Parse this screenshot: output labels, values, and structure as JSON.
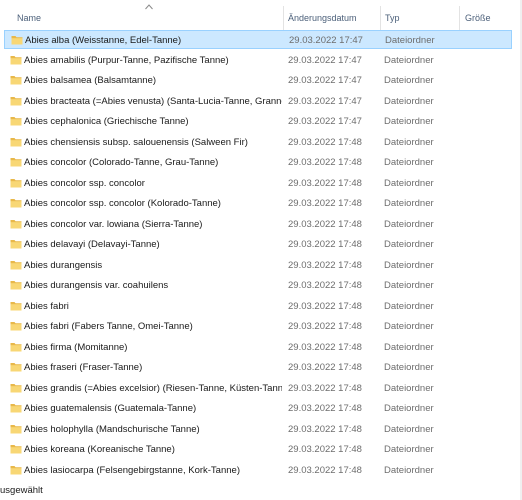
{
  "columns": {
    "name": "Name",
    "date": "Änderungsdatum",
    "type": "Typ",
    "size": "Größe"
  },
  "icons": {
    "sort": "chevron-up-icon",
    "folder": "folder-icon"
  },
  "colors": {
    "selection_fill": "#cce8ff",
    "selection_border": "#99d1ff",
    "folder": "#f8d775"
  },
  "rows": [
    {
      "name": "Abies alba (Weisstanne, Edel-Tanne)",
      "date": "29.03.2022 17:47",
      "type": "Dateiordner",
      "selected": true
    },
    {
      "name": "Abies amabilis (Purpur-Tanne, Pazifische Tanne)",
      "date": "29.03.2022 17:47",
      "type": "Dateiordner"
    },
    {
      "name": "Abies balsamea (Balsamtanne)",
      "date": "29.03.2022 17:47",
      "type": "Dateiordner"
    },
    {
      "name": "Abies bracteata (=Abies venusta) (Santa-Lucia-Tanne, Grannen-Tanne)",
      "date": "29.03.2022 17:47",
      "type": "Dateiordner"
    },
    {
      "name": "Abies cephalonica (Griechische Tanne)",
      "date": "29.03.2022 17:47",
      "type": "Dateiordner"
    },
    {
      "name": "Abies chensiensis subsp. salouenensis (Salween Fir)",
      "date": "29.03.2022 17:48",
      "type": "Dateiordner"
    },
    {
      "name": "Abies concolor (Colorado-Tanne, Grau-Tanne)",
      "date": "29.03.2022 17:48",
      "type": "Dateiordner"
    },
    {
      "name": "Abies concolor ssp. concolor",
      "date": "29.03.2022 17:48",
      "type": "Dateiordner"
    },
    {
      "name": "Abies concolor ssp. concolor (Kolorado-Tanne)",
      "date": "29.03.2022 17:48",
      "type": "Dateiordner"
    },
    {
      "name": "Abies concolor var. lowiana (Sierra-Tanne)",
      "date": "29.03.2022 17:48",
      "type": "Dateiordner"
    },
    {
      "name": "Abies delavayi (Delavayi-Tanne)",
      "date": "29.03.2022 17:48",
      "type": "Dateiordner"
    },
    {
      "name": "Abies durangensis",
      "date": "29.03.2022 17:48",
      "type": "Dateiordner"
    },
    {
      "name": "Abies durangensis var. coahuilens",
      "date": "29.03.2022 17:48",
      "type": "Dateiordner"
    },
    {
      "name": "Abies fabri",
      "date": "29.03.2022 17:48",
      "type": "Dateiordner"
    },
    {
      "name": "Abies fabri (Fabers Tanne, Omei-Tanne)",
      "date": "29.03.2022 17:48",
      "type": "Dateiordner"
    },
    {
      "name": "Abies firma (Momitanne)",
      "date": "29.03.2022 17:48",
      "type": "Dateiordner"
    },
    {
      "name": "Abies fraseri (Fraser-Tanne)",
      "date": "29.03.2022 17:48",
      "type": "Dateiordner"
    },
    {
      "name": "Abies grandis (=Abies excelsior) (Riesen-Tanne, Küsten-Tanne)",
      "date": "29.03.2022 17:48",
      "type": "Dateiordner"
    },
    {
      "name": "Abies guatemalensis (Guatemala-Tanne)",
      "date": "29.03.2022 17:48",
      "type": "Dateiordner"
    },
    {
      "name": "Abies holophylla (Mandschurische Tanne)",
      "date": "29.03.2022 17:48",
      "type": "Dateiordner"
    },
    {
      "name": "Abies koreana (Koreanische Tanne)",
      "date": "29.03.2022 17:48",
      "type": "Dateiordner"
    },
    {
      "name": "Abies lasiocarpa (Felsengebirgstanne, Kork-Tanne)",
      "date": "29.03.2022 17:48",
      "type": "Dateiordner"
    }
  ],
  "status": {
    "text": "usgewählt"
  }
}
